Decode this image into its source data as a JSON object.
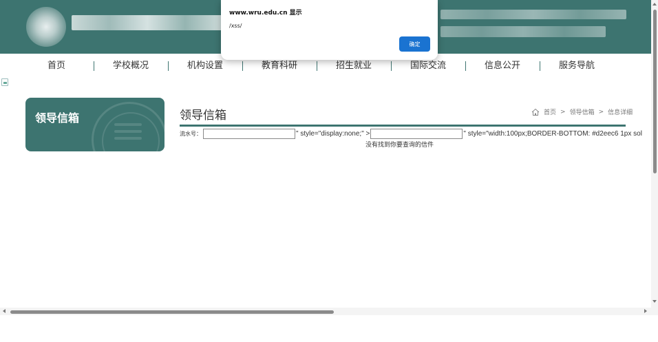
{
  "nav": {
    "items": [
      "首页",
      "学校概况",
      "机构设置",
      "教育科研",
      "招生就业",
      "国际交流",
      "信息公开",
      "服务导航"
    ]
  },
  "sidebar": {
    "title": "领导信箱"
  },
  "main": {
    "title": "领导信箱",
    "breadcrumb": [
      "首页",
      ">",
      "领导信箱",
      ">",
      "信息详细"
    ],
    "form": {
      "serial_label": "流水号：",
      "leak_1": "\" style=\"display:none;\" >",
      "leak_2": "\" style=\"width:100px;BORDER-BOTTOM: #d2eec6 1px sol"
    },
    "not_found": "没有找到你要查询的信件"
  },
  "alert": {
    "title": "www.wru.edu.cn 显示",
    "message": "/xss/",
    "ok_label": "确定"
  },
  "colors": {
    "brand": "#3d7470",
    "alert_button": "#1a73d1"
  }
}
